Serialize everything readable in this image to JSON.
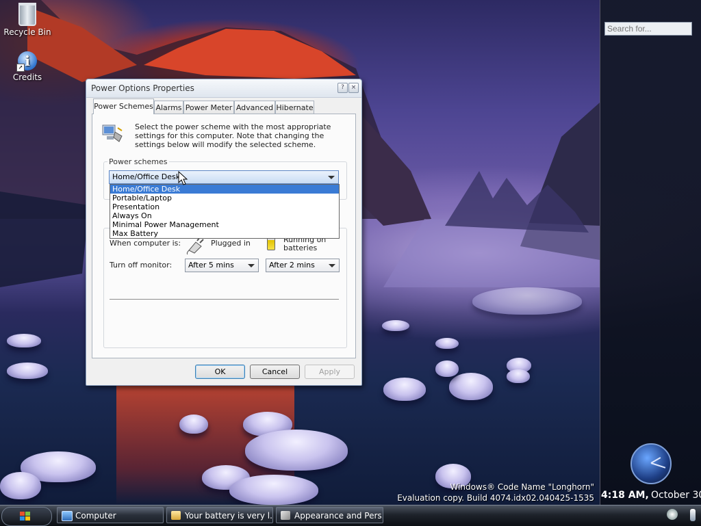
{
  "desktop": {
    "icons": [
      {
        "label": "Recycle Bin",
        "icon": "recycle-bin-icon"
      },
      {
        "label": "Credits",
        "icon": "info-icon"
      }
    ],
    "watermark": {
      "line1": "Windows® Code Name \"Longhorn\"",
      "line2": "Evaluation copy. Build 4074.idx02.040425-1535"
    }
  },
  "sidebar": {
    "search_placeholder": "Search for...",
    "time": "4:18 AM,",
    "date": "October 30"
  },
  "taskbar": {
    "start_icon": "windows-flag-icon",
    "buttons": [
      {
        "label": "Computer",
        "icon": "computer-icon"
      },
      {
        "label": "Your battery is very l...",
        "icon": "folder-icon"
      },
      {
        "label": "Appearance and Pers...",
        "icon": "control-panel-icon"
      }
    ],
    "tray_icons": [
      "volume-icon",
      "battery-icon"
    ]
  },
  "dialog": {
    "title": "Power Options Properties",
    "help_icon": "?",
    "close_icon": "×",
    "tabs": [
      {
        "label": "Power Schemes",
        "active": true
      },
      {
        "label": "Alarms",
        "active": false
      },
      {
        "label": "Power Meter",
        "active": false
      },
      {
        "label": "Advanced",
        "active": false
      },
      {
        "label": "Hibernate",
        "active": false
      }
    ],
    "description": "Select the power scheme with the most appropriate settings for this computer. Note that changing the settings below will modify the selected scheme.",
    "power_schemes": {
      "group_label": "Power schemes",
      "selected": "Home/Office Desk",
      "options": [
        "Home/Office Desk",
        "Portable/Laptop",
        "Presentation",
        "Always On",
        "Minimal Power Management",
        "Max Battery"
      ]
    },
    "settings": {
      "when_label": "When computer is:",
      "plugged_in_label": "Plugged in",
      "batteries_line1": "Running on",
      "batteries_line2": "batteries",
      "monitor_label": "Turn off monitor:",
      "monitor_plugged_value": "After 5 mins",
      "monitor_battery_value": "After 2 mins"
    },
    "buttons": {
      "ok": "OK",
      "cancel": "Cancel",
      "apply": "Apply"
    }
  },
  "colors": {
    "selection": "#3a7bd5",
    "sidebar_bg": "#141928",
    "taskbar_bg": "#1e232b"
  }
}
